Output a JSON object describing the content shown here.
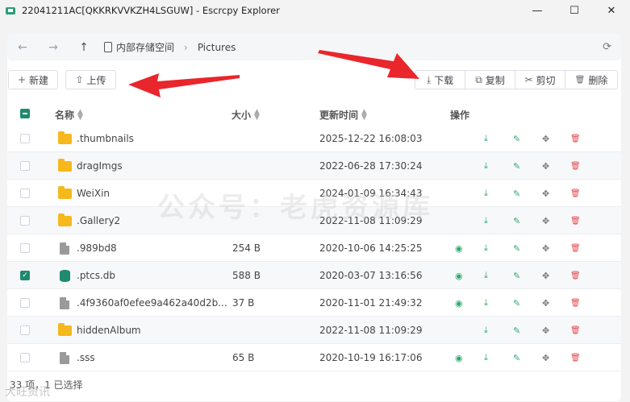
{
  "window": {
    "title": "22041211AC[QKKRKVVKZH4LSGUW] - Escrcpy Explorer",
    "minimize_label": "—",
    "maximize_label": "☐",
    "close_label": "✕"
  },
  "nav": {
    "back": "←",
    "forward": "→",
    "up": "↑",
    "breadcrumb_root": "内部存储空间",
    "breadcrumb_sep": "›",
    "breadcrumb_current": "Pictures",
    "refresh": "⟳"
  },
  "toolbar": {
    "new_icon": "+",
    "new_label": "新建",
    "upload_icon": "⇧",
    "upload_label": "上传",
    "download_icon": "⤓",
    "download_label": "下载",
    "copy_icon": "⧉",
    "copy_label": "复制",
    "cut_icon": "✂",
    "cut_label": "剪切",
    "delete_icon": "🗑",
    "delete_label": "删除"
  },
  "table": {
    "headers": {
      "name": "名称",
      "size": "大小",
      "updated": "更新时间",
      "actions": "操作"
    },
    "rows": [
      {
        "type": "folder",
        "name": ".thumbnails",
        "size": "",
        "updated": "2025-12-22 16:08:03",
        "checked": false,
        "preview": false
      },
      {
        "type": "folder",
        "name": "dragImgs",
        "size": "",
        "updated": "2022-06-28 17:30:24",
        "checked": false,
        "preview": false
      },
      {
        "type": "folder",
        "name": "WeiXin",
        "size": "",
        "updated": "2024-01-09 16:34:43",
        "checked": false,
        "preview": false
      },
      {
        "type": "folder",
        "name": ".Gallery2",
        "size": "",
        "updated": "2022-11-08 11:09:29",
        "checked": false,
        "preview": false
      },
      {
        "type": "file",
        "name": ".989bd8",
        "size": "254 B",
        "updated": "2020-10-06 14:25:25",
        "checked": false,
        "preview": true
      },
      {
        "type": "db",
        "name": ".ptcs.db",
        "size": "588 B",
        "updated": "2020-03-07 13:16:56",
        "checked": true,
        "preview": true
      },
      {
        "type": "file",
        "name": ".4f9360af0efee9a462a40d2b...",
        "size": "37 B",
        "updated": "2020-11-01 21:49:32",
        "checked": false,
        "preview": true
      },
      {
        "type": "folder",
        "name": "hiddenAlbum",
        "size": "",
        "updated": "2022-11-08 11:09:29",
        "checked": false,
        "preview": false
      },
      {
        "type": "file",
        "name": ".sss",
        "size": "65 B",
        "updated": "2020-10-19 16:17:06",
        "checked": false,
        "preview": true
      }
    ]
  },
  "icons": {
    "preview": "◉",
    "download": "⤓",
    "edit": "✎",
    "move": "✥",
    "delete": "🗑"
  },
  "status": {
    "text": "33 项，1 已选择"
  },
  "watermarks": {
    "center": "公众号：老虎资源库",
    "corner": "大旺资讯"
  },
  "colors": {
    "accent": "#1e8a6e",
    "danger": "#e5484d",
    "folder": "#f5b91d",
    "arrow": "#e8262b"
  }
}
